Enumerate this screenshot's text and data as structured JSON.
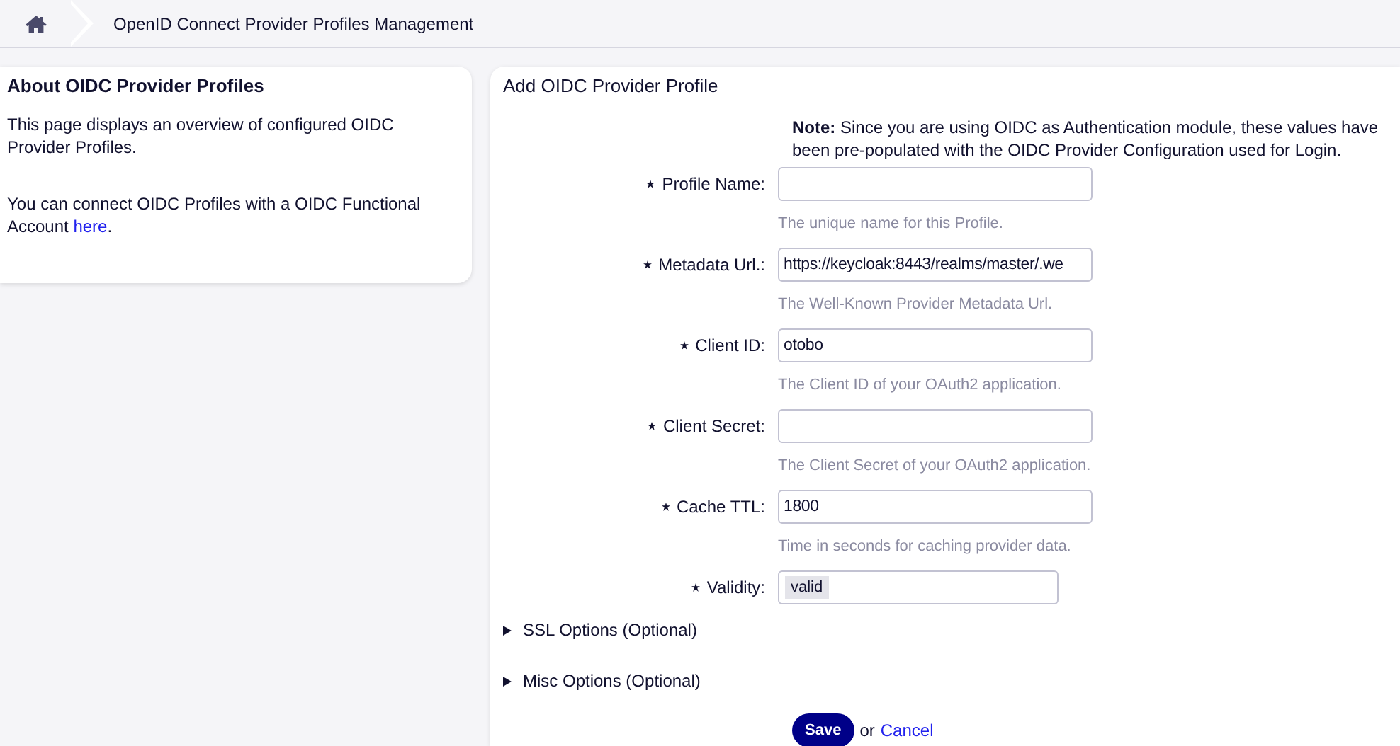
{
  "breadcrumb": {
    "title": "OpenID Connect Provider Profiles Management"
  },
  "sidebar": {
    "title": "About OIDC Provider Profiles",
    "paragraph": "This page displays an overview of configured OIDC Provider Profiles.",
    "link_paragraph": {
      "before": "You can connect OIDC Profiles with a OIDC Functional Account",
      "link": "here",
      "after": "."
    }
  },
  "form": {
    "title": "Add OIDC Provider Profile",
    "note": "**Note:** Since you are using OIDC as Authentication module, these values have been pre-populated with the OIDC Provider Configuration used for Login.",
    "fields": [
      {
        "kind": "text",
        "label": "Profile Name:",
        "required": true,
        "hint": "The unique name for this Profile."
      },
      {
        "kind": "text",
        "label": "Metadata Url.:",
        "required": true,
        "value": "https://keycloak:8443/realms/master/.we",
        "hint": "The Well-Known Provider Metadata Url."
      },
      {
        "kind": "text",
        "label": "Client ID:",
        "required": true,
        "value": "otobo",
        "hint": "The Client ID of your OAuth2 application."
      },
      {
        "kind": "text",
        "label": "Client Secret:",
        "required": true,
        "hint": "The Client Secret of your OAuth2 application."
      },
      {
        "kind": "text",
        "label": "Cache TTL:",
        "required": true,
        "value": "1800",
        "hint": "Time in seconds for caching provider data."
      },
      {
        "kind": "select",
        "label": "Validity:",
        "required": true,
        "value": "valid"
      }
    ],
    "sections": [
      {
        "label": "SSL Options (Optional)",
        "expanded": false
      },
      {
        "label": "Misc Options (Optional)",
        "expanded": false
      }
    ],
    "save": "Save",
    "or": "or",
    "cancel": "Cancel"
  }
}
